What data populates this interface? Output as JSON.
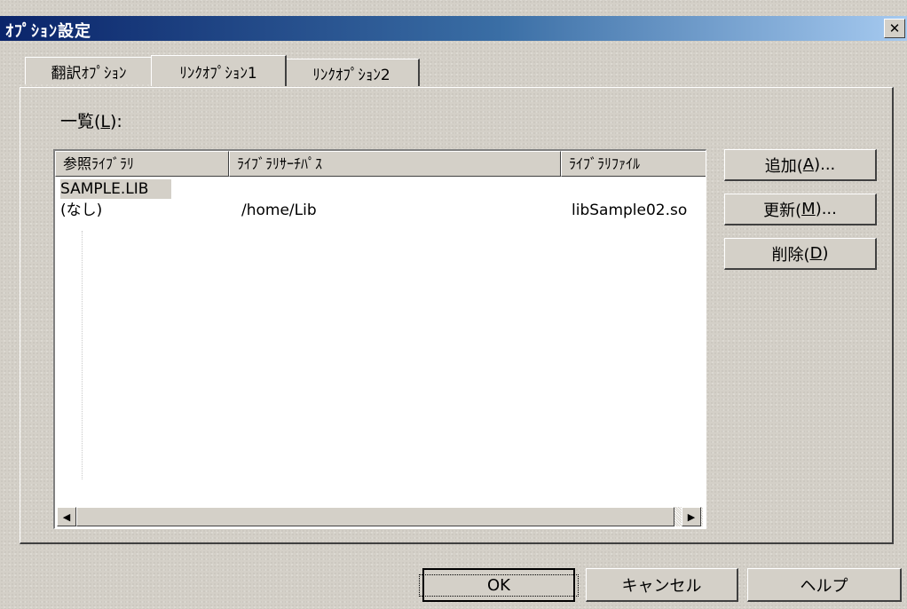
{
  "window": {
    "title": "ｵﾌﾟｼｮﾝ設定",
    "close_glyph": "✕"
  },
  "tabs": [
    {
      "label": "翻訳ｵﾌﾟｼｮﾝ",
      "active": false
    },
    {
      "label": "ﾘﾝｸｵﾌﾟｼｮﾝ1",
      "active": true
    },
    {
      "label": "ﾘﾝｸｵﾌﾟｼｮﾝ2",
      "active": false
    }
  ],
  "list": {
    "label_prefix": "一覧(",
    "label_key": "L",
    "label_suffix": "):",
    "columns": [
      "参照ﾗｲﾌﾞﾗﾘ",
      "ﾗｲﾌﾞﾗﾘｻｰﾁﾊﾟｽ",
      "ﾗｲﾌﾞﾗﾘﾌｧｲﾙ"
    ],
    "rows": [
      {
        "library": "SAMPLE.LIB",
        "search_path": "",
        "file": "",
        "selected": true
      },
      {
        "library": "(なし)",
        "search_path": "/home/Lib",
        "file": "libSample02.so",
        "selected": false
      }
    ],
    "scroll_left_glyph": "◀",
    "scroll_right_glyph": "▶"
  },
  "side_buttons": {
    "add": {
      "prefix": "追加(",
      "key": "A",
      "suffix": ")..."
    },
    "update": {
      "prefix": "更新(",
      "key": "M",
      "suffix": ")..."
    },
    "delete": {
      "prefix": "削除(",
      "key": "D",
      "suffix": ")"
    }
  },
  "footer_buttons": {
    "ok": "OK",
    "cancel": "キャンセル",
    "help": "ヘルプ"
  },
  "colors": {
    "title_gradient_start": "#0a246a",
    "title_gradient_end": "#a6caf0",
    "dialog_face": "#d4d0c8",
    "list_background": "#ffffff"
  },
  "icons": {
    "close": "close-icon",
    "scroll_left": "arrow-left-icon",
    "scroll_right": "arrow-right-icon"
  }
}
